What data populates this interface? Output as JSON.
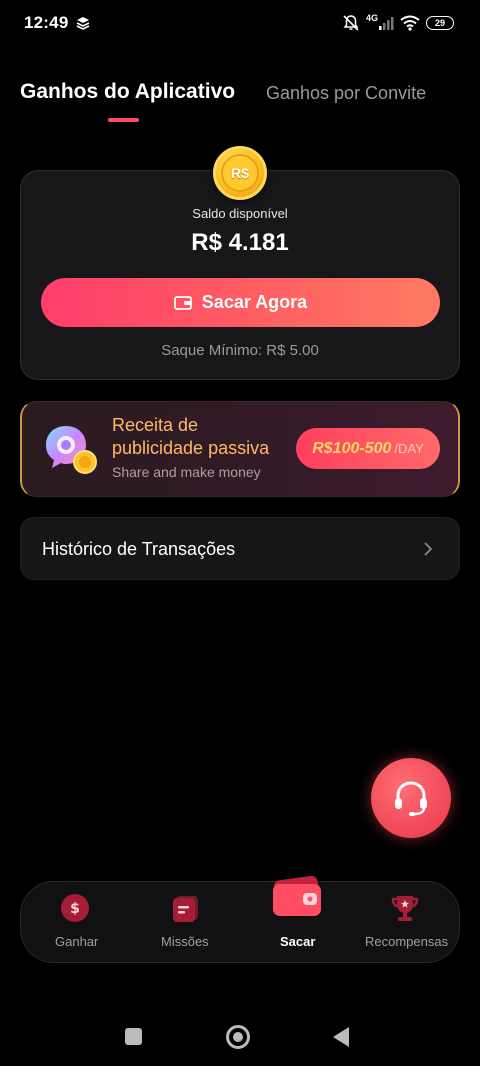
{
  "status_bar": {
    "time": "12:49",
    "network": "4G",
    "battery": "29"
  },
  "tabs": {
    "active": "Ganhos do Aplicativo",
    "inactive": "Ganhos por Convite"
  },
  "balance": {
    "coin_symbol": "R$",
    "label": "Saldo disponível",
    "value": "R$ 4.181",
    "withdraw_label": "Sacar Agora",
    "minimum_note": "Saque Mínimo: R$ 5.00"
  },
  "promo": {
    "title": "Receita de publicidade passiva",
    "subtitle": "Share and make money",
    "range": "R$100-500",
    "unit": "/DAY"
  },
  "history": {
    "label": "Histórico de Transações"
  },
  "bottom_nav": {
    "items": [
      {
        "label": "Ganhar",
        "icon": "dollar-icon"
      },
      {
        "label": "Missões",
        "icon": "tasks-icon"
      },
      {
        "label": "Sacar",
        "icon": "wallet-icon"
      },
      {
        "label": "Recompensas",
        "icon": "trophy-icon"
      }
    ],
    "active_index": 2
  },
  "colors": {
    "accent": "#ff4d63",
    "promo_title": "#ffb86a",
    "promo_range": "#ffd56a",
    "coin": "#ffc62b"
  }
}
